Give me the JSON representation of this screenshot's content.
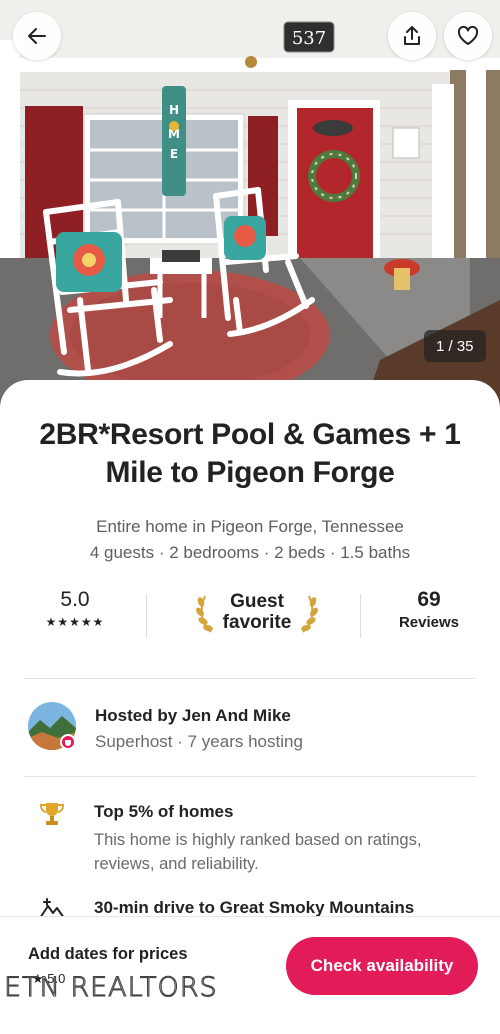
{
  "header": {
    "house_number": "537",
    "photo_counter": "1 / 35",
    "porch_sign": "HOME",
    "icons": {
      "back": "arrow-left-icon",
      "share": "share-icon",
      "favorite": "heart-icon"
    }
  },
  "listing": {
    "title": "2BR*Resort Pool & Games + 1 Mile to Pigeon Forge",
    "location_line": "Entire home in Pigeon Forge, Tennessee",
    "details_line": "4 guests · 2 bedrooms · 2 beds · 1.5 baths"
  },
  "stats": {
    "rating": "5.0",
    "stars": "★★★★★",
    "guest_favorite_line1": "Guest",
    "guest_favorite_line2": "favorite",
    "reviews_count": "69",
    "reviews_label": "Reviews"
  },
  "host": {
    "name_line": "Hosted by Jen And Mike",
    "sub_line": "Superhost · 7 years hosting"
  },
  "highlights": [
    {
      "icon": "trophy-icon",
      "title": "Top 5% of homes",
      "description": "This home is highly ranked based on ratings, reviews, and reliability."
    },
    {
      "icon": "mountain-icon",
      "title": "30-min drive to Great Smoky Mountains",
      "description": ""
    }
  ],
  "footer": {
    "price_label": "Add dates for prices",
    "mini_rating": "★ 5.0",
    "cta_label": "Check availability",
    "watermark": "ETN REALTORS"
  },
  "colors": {
    "accent": "#e21c58",
    "text_primary": "#222222",
    "text_secondary": "#6a6a6a"
  }
}
